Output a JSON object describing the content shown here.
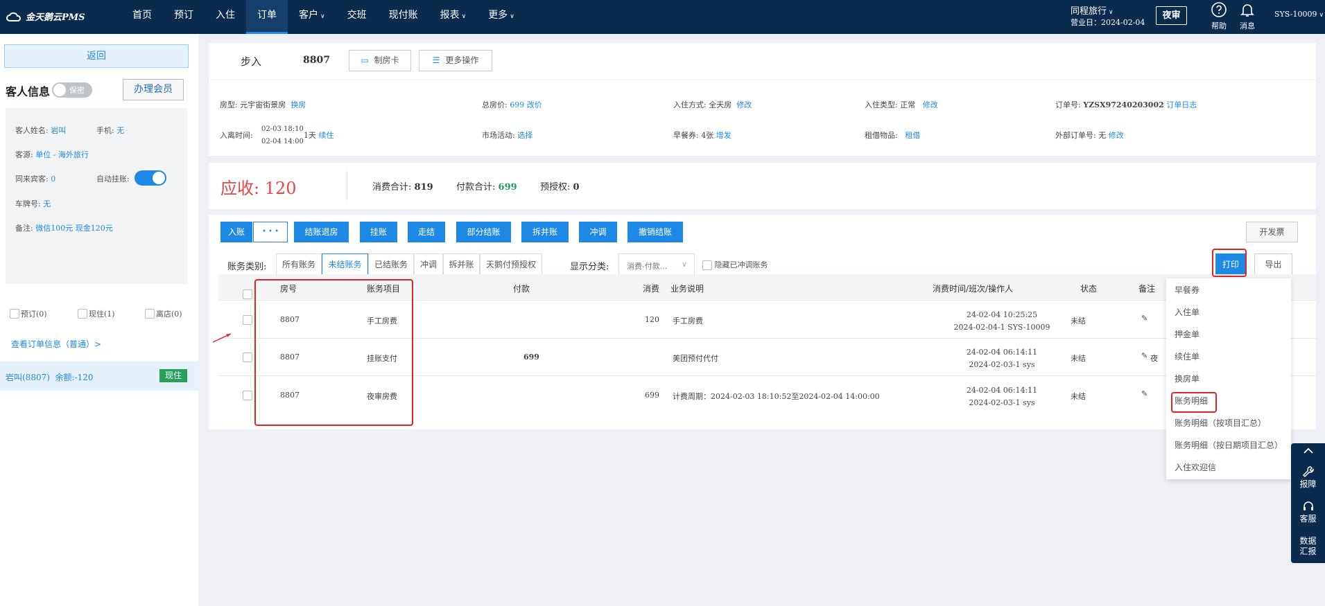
{
  "topbar": {
    "logo": "金天鹅云PMS",
    "nav": [
      {
        "label": "首页",
        "dropdown": false
      },
      {
        "label": "预订",
        "dropdown": false
      },
      {
        "label": "入住",
        "dropdown": false
      },
      {
        "label": "订单",
        "dropdown": false,
        "active": true
      },
      {
        "label": "客户",
        "dropdown": true
      },
      {
        "label": "交班",
        "dropdown": false
      },
      {
        "label": "现付账",
        "dropdown": false
      },
      {
        "label": "报表",
        "dropdown": true
      },
      {
        "label": "更多",
        "dropdown": true
      }
    ],
    "org": "同程旅行",
    "business_date": "营业日：2024-02-04",
    "night_audit": "夜审",
    "help": "帮助",
    "messages": "消息",
    "user": "SYS-10009"
  },
  "left": {
    "back": "返回",
    "guest_info": "客人信息",
    "secret_toggle": "保密",
    "member_btn": "办理会员",
    "guest_name_label": "客人姓名:",
    "guest_name": "岩叫",
    "phone_label": "手机:",
    "phone": "无",
    "source_label": "客源:",
    "source": "单位 - 海外旅行",
    "companions_label": "同来宾客:",
    "companions": "0",
    "auto_charge_label": "自动挂账:",
    "plate_label": "车牌号:",
    "plate": "无",
    "remark_label": "备注:",
    "remark": "微信100元 现金120元",
    "filters": [
      "预订(0)",
      "现住(1)",
      "离店(0)"
    ],
    "order_link": "查看订单信息（普通）>",
    "room_name": "岩叫(8807)",
    "room_balance": "余额:-120",
    "room_status": "现住"
  },
  "header": {
    "status": "步入",
    "room": "8807",
    "make_card": "制房卡",
    "more_ops": "更多操作"
  },
  "info": {
    "room_type_label": "房型:",
    "room_type": "元宇宙街景房",
    "change_room": "换房",
    "total_label": "总房价:",
    "total": "699",
    "change_price": "改价",
    "checkin_mode_label": "入住方式:",
    "checkin_mode": "全天房",
    "modify": "修改",
    "checkin_type_label": "入住类型:",
    "checkin_type": "正常",
    "order_no_label": "订单号:",
    "order_no": "YZSX97240203002",
    "order_log": "订单日志",
    "stay_label": "入离时间:",
    "stay_in": "02-03 18:10",
    "stay_out": "02-04 14:00",
    "nights": "1天",
    "extend": "续住",
    "activity_label": "市场活动:",
    "select": "选择",
    "breakfast_label": "早餐券:",
    "breakfast": "4张",
    "add_issue": "增发",
    "rental_label": "租借物品:",
    "rental": "租借",
    "ext_order_label": "外部订单号:",
    "ext_order": "无"
  },
  "summary": {
    "receivable_label": "应收:",
    "receivable": "120",
    "consume_label": "消费合计:",
    "consume": "819",
    "payment_label": "付款合计:",
    "payment": "699",
    "preauth_label": "预授权:",
    "preauth": "0"
  },
  "billing": {
    "buttons": [
      "入账",
      "结账退房",
      "挂账",
      "走结",
      "部分结账",
      "拆并账",
      "冲调",
      "撤销结账"
    ],
    "more_dots": "• • •",
    "invoice": "开发票",
    "category_label": "账务类别:",
    "tabs": [
      "所有账务",
      "未结账务",
      "已结账务",
      "冲调",
      "拆并账",
      "天鹅付预授权"
    ],
    "active_tab": "未结账务",
    "display_label": "显示分类:",
    "display_value": "消费-付款...",
    "hide_label": "隐藏已冲调账务",
    "print": "打印",
    "export": "导出",
    "columns": [
      "房号",
      "账务项目",
      "付款",
      "消费",
      "业务说明",
      "消费时间/班次/操作人",
      "状态",
      "备注"
    ],
    "rows": [
      {
        "room": "8807",
        "item": "手工房费",
        "payment": "",
        "consume": "120",
        "desc": "手工房费",
        "time": "24-02-04 10:25:25",
        "shift": "2024-02-04-1 SYS-10009",
        "status": "未结",
        "note": ""
      },
      {
        "room": "8807",
        "item": "挂账支付",
        "payment": "699",
        "consume": "",
        "desc": "美团预付代付",
        "time": "24-02-04 06:14:11",
        "shift": "2024-02-03-1 sys",
        "status": "未结",
        "note": "夜"
      },
      {
        "room": "8807",
        "item": "夜审房费",
        "payment": "",
        "consume": "699",
        "desc": "计费周期：2024-02-03 18:10:52至2024-02-04 14:00:00",
        "time": "24-02-04 06:14:11",
        "shift": "2024-02-03-1 sys",
        "status": "未结",
        "note": ""
      }
    ]
  },
  "print_menu": [
    "早餐券",
    "入住单",
    "押金单",
    "续住单",
    "换房单",
    "账务明细",
    "账务明细（按项目汇总）",
    "账务明细（按日期项目汇总）",
    "入住欢迎信"
  ],
  "side_tools": {
    "report": "报障",
    "service": "客服",
    "data1": "数据",
    "data2": "汇报"
  },
  "colors": {
    "topbar": "#0a2a4e",
    "accent": "#1e88e5",
    "receivable": "#e84545",
    "payment": "#1e9e5a",
    "highlight": "#e02424"
  }
}
